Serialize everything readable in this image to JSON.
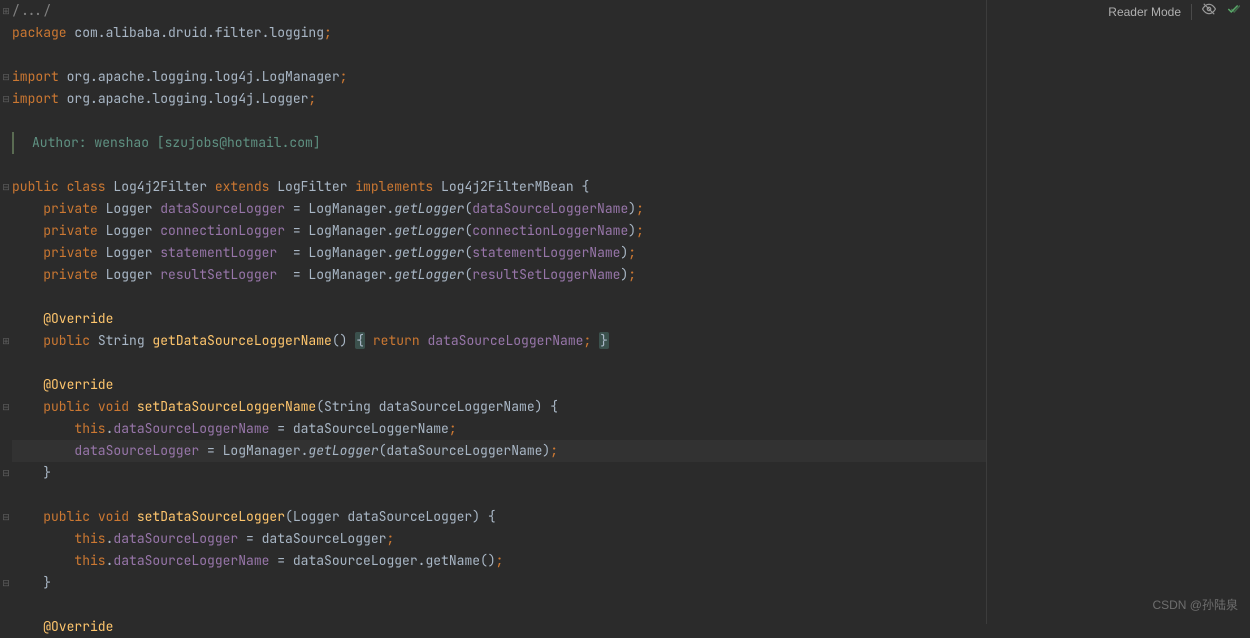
{
  "topbar": {
    "reader_mode": "Reader Mode"
  },
  "gutter": {
    "fold_open": "⊟",
    "fold_close": "⊞"
  },
  "code": {
    "fold_marker": "/.../",
    "l01_kw": "package",
    "l01_val": " com.alibaba.druid.filter.logging",
    "semi": ";",
    "l03_kw": "import",
    "l03_val": " org.apache.logging.log4j.LogManager",
    "l04_kw": "import",
    "l04_val": " org.apache.logging.log4j.Logger",
    "l06_author": "Author: wenshao [szujobs@hotmail.com]",
    "l07_p1": "public class",
    "l07_p2": " Log4j2Filter ",
    "l07_p3": "extends",
    "l07_p4": " LogFilter ",
    "l07_p5": "implements",
    "l07_p6": " Log4j2FilterMBean {",
    "l08_ind": "    ",
    "l08_priv": "private",
    "l08_type": " Logger ",
    "l08_field": "dataSourceLogger",
    "l08_eq": " = LogManager.",
    "l08_meth": "getLogger",
    "l08_op": "(",
    "l08_arg": "dataSourceLoggerName",
    "l08_cl": ")",
    "l09_field": "connectionLogger",
    "l09_arg": "connectionLoggerName",
    "l10_field": "statementLogger",
    "l10_arg": "statementLoggerName",
    "l11_field": "resultSetLogger",
    "l11_arg": "resultSetLoggerName",
    "l13_ann": "@Override",
    "l14_ind": "    ",
    "l14_pub": "public",
    "l14_ret": " String ",
    "l14_name": "getDataSourceLoggerName",
    "l14_paren": "() ",
    "l14_ob": "{",
    "l14_kw": " return ",
    "l14_val": "dataSourceLoggerName",
    "l14_end": "; ",
    "l14_cb": "}",
    "l16_ann": "@Override",
    "l17_pub": "public",
    "l17_ret": " void ",
    "l17_name": "setDataSourceLoggerName",
    "l17_params": "(String dataSourceLoggerName) {",
    "l18_ind": "        ",
    "l18_this": "this",
    "l18_dot": ".",
    "l18_field": "dataSourceLoggerName",
    "l18_rest": " = dataSourceLoggerName",
    "l19_ind": "        ",
    "l19_field": "dataSourceLogger",
    "l19_eq": " = LogManager.",
    "l19_meth": "getLogger",
    "l19_paren": "(dataSourceLoggerName)",
    "l20_ind": "    }",
    "l22_pub": "public",
    "l22_ret": " void ",
    "l22_name": "setDataSourceLogger",
    "l22_params": "(Logger dataSourceLogger) {",
    "l23_this": "this",
    "l23_field": "dataSourceLogger",
    "l23_rest": " = dataSourceLogger",
    "l24_this": "this",
    "l24_field": "dataSourceLoggerName",
    "l24_rest": " = dataSourceLogger.getName()",
    "l25_ind": "    }",
    "l27_ann": "@Override"
  },
  "watermark": "CSDN @孙陆泉"
}
